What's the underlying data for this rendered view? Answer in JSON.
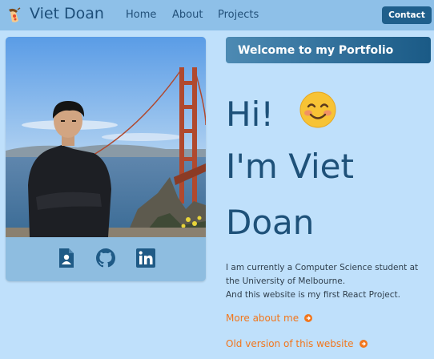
{
  "header": {
    "brand": "Viet Doan",
    "nav": {
      "home": "Home",
      "about": "About",
      "projects": "Projects"
    },
    "contact_label": "Contact"
  },
  "profile": {
    "photo_alt": "Viet Doan at the Golden Gate Bridge",
    "socials": [
      "resume-icon",
      "github-icon",
      "linkedin-icon"
    ]
  },
  "hero": {
    "welcome": "Welcome to my Portfolio",
    "line1": "Hi!",
    "emoji": "😊",
    "line2": "I'm Viet",
    "line3": "Doan",
    "intro1": "I am currently a Computer Science student at the University of Melbourne.",
    "intro2": "And this website is my first React Project.",
    "link1": "More about me",
    "link2": "Old version of this website"
  },
  "colors": {
    "background": "#bfe0fb",
    "navbar": "#8ec0e8",
    "primary": "#1e5179",
    "accent": "#f2761c"
  }
}
